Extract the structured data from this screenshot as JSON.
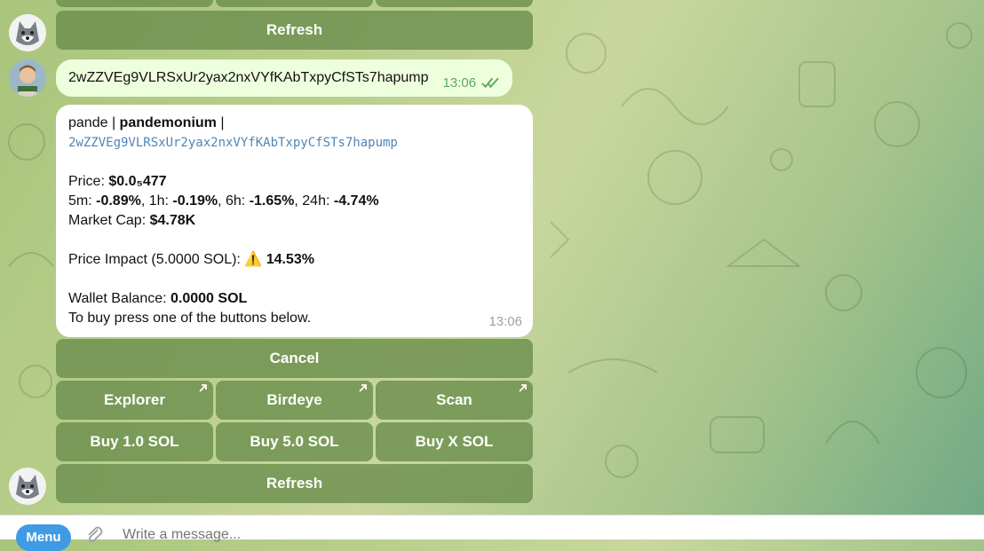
{
  "keyboard_top": {
    "refresh_label": "Refresh"
  },
  "outgoing": {
    "text": "2wZZVEg9VLRSxUr2yax2nxVYfKAbTxpyCfSTs7hapump",
    "time": "13:06"
  },
  "token_card": {
    "symbol": "pande",
    "sep1": " | ",
    "name": "pandemonium",
    "sep2": " |",
    "address": "2wZZVEg9VLRSxUr2yax2nxVYfKAbTxpyCfSTs7hapump",
    "price_label": "Price: ",
    "price_value": "$0.0₅477",
    "ch_5m_label": "5m: ",
    "ch_5m": "-0.89%",
    "ch_1h_label": ", 1h: ",
    "ch_1h": "-0.19%",
    "ch_6h_label": ", 6h: ",
    "ch_6h": "-1.65%",
    "ch_24h_label": ", 24h: ",
    "ch_24h": "-4.74%",
    "mcap_label": "Market Cap: ",
    "mcap_value": "$4.78K",
    "impact_label": "Price Impact (5.0000 SOL): ",
    "impact_icon": "⚠️",
    "impact_value": "14.53%",
    "wallet_label": "Wallet Balance: ",
    "wallet_value": "0.0000 SOL",
    "instruction": "To buy press one of the buttons below.",
    "time": "13:06"
  },
  "keyboard": {
    "cancel": "Cancel",
    "explorer": "Explorer",
    "birdeye": "Birdeye",
    "scan": "Scan",
    "buy_1": "Buy 1.0 SOL",
    "buy_5": "Buy 5.0 SOL",
    "buy_x": "Buy X SOL",
    "refresh": "Refresh"
  },
  "composer": {
    "menu_label": "Menu",
    "placeholder": "Write a message..."
  },
  "colors": {
    "button_bg": "#688c4a",
    "outgoing_bubble": "#eeffde",
    "incoming_bubble": "#ffffff",
    "link_mono": "#4f86b7",
    "menu_button": "#3f9be3"
  }
}
